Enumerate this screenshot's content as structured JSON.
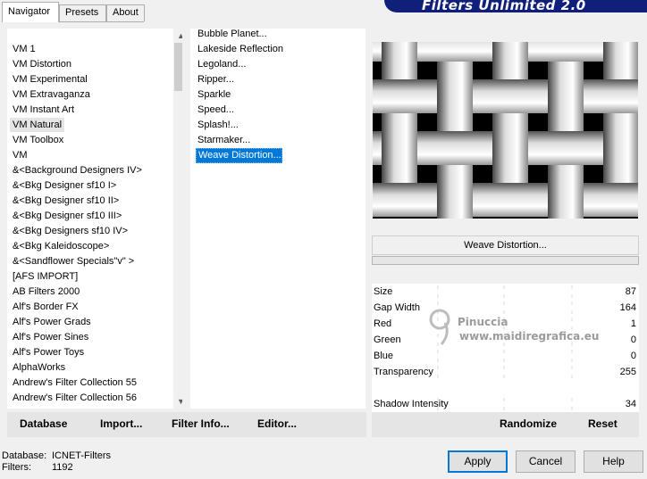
{
  "tabs": [
    "Navigator",
    "Presets",
    "About"
  ],
  "banner": {
    "title": "Filters Unlimited 2.0"
  },
  "categories": [
    "VM 1",
    "VM Distortion",
    "VM Experimental",
    "VM Extravaganza",
    "VM Instant Art",
    "VM Natural",
    "VM Toolbox",
    "VM",
    "&<Background Designers IV>",
    "&<Bkg Designer sf10 I>",
    "&<Bkg Designer sf10 II>",
    "&<Bkg Designer sf10 III>",
    "&<Bkg Designers sf10 IV>",
    "&<Bkg Kaleidoscope>",
    "&<Sandflower Specials\"v\" >",
    "[AFS IMPORT]",
    "AB Filters 2000",
    "Alf's Border FX",
    "Alf's Power Grads",
    "Alf's Power Sines",
    "Alf's Power Toys",
    "AlphaWorks",
    "Andrew's Filter Collection 55",
    "Andrew's Filter Collection 56"
  ],
  "selected_category": "VM Natural",
  "filters": [
    "Bubble Planet...",
    "Lakeside Reflection",
    "Legoland...",
    "Ripper...",
    "Sparkle",
    "Speed...",
    "Splash!...",
    "Starmaker...",
    "Weave Distortion..."
  ],
  "selected_filter": "Weave Distortion...",
  "filter_title": "Weave Distortion...",
  "params": [
    {
      "label": "Size",
      "value": "87"
    },
    {
      "label": "Gap Width",
      "value": "164"
    },
    {
      "label": "Red",
      "value": "1"
    },
    {
      "label": "Green",
      "value": "0"
    },
    {
      "label": "Blue",
      "value": "0"
    },
    {
      "label": "Transparency",
      "value": "255"
    },
    {
      "label": "Shadow Intensity",
      "value": "34"
    }
  ],
  "watermark": {
    "line1": "Pinuccia",
    "line2": "www.maidiregrafica.eu"
  },
  "toolbar": {
    "database": "Database",
    "import": "Import...",
    "filter_info": "Filter Info...",
    "editor": "Editor...",
    "randomize": "Randomize",
    "reset": "Reset"
  },
  "status": {
    "database_label": "Database:",
    "database_value": "ICNET-Filters",
    "filters_label": "Filters:",
    "filters_value": "1192"
  },
  "buttons": {
    "apply": "Apply",
    "cancel": "Cancel",
    "help": "Help"
  },
  "colors": {
    "selection": "#0078d7",
    "banner": "#10207a"
  }
}
